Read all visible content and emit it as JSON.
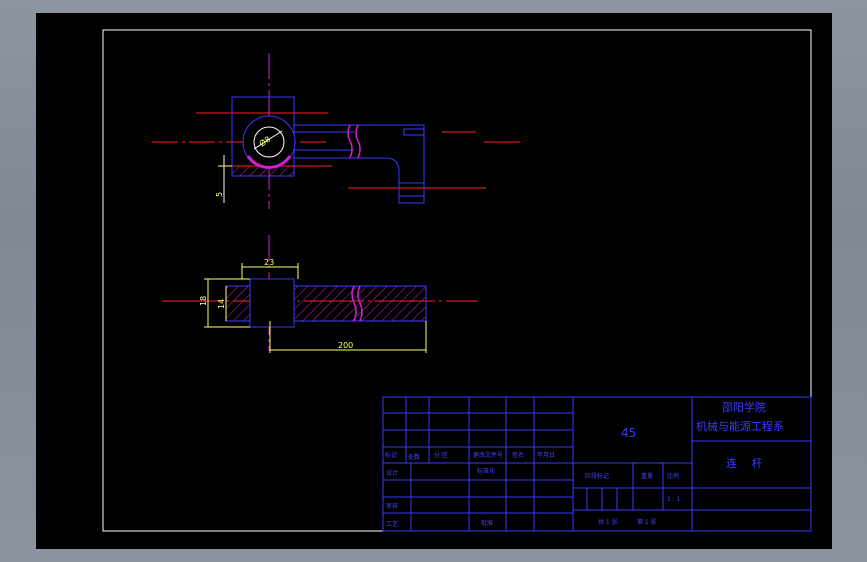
{
  "drawing": {
    "dimensions": {
      "d_hole": "Ø8",
      "d_offset": "5",
      "d_width": "23",
      "d_height_outer": "18",
      "d_height_inner": "14",
      "d_length": "200"
    }
  },
  "title_block": {
    "material": "45",
    "school": "邵阳学院",
    "department": "机械与能源工程系",
    "part_name": "连　 杆",
    "labels": {
      "mark": "标记",
      "count": "处数",
      "zone": "分 区",
      "change_doc": "更改文件号",
      "sign": "签名",
      "date": "年月日",
      "design": "设计",
      "standardize": "标准化",
      "stage_mark": "阶段标记",
      "weight": "重量",
      "scale": "比例",
      "scale_value": "1 : 1",
      "review": "审核",
      "process": "工艺",
      "approve": "批准",
      "sheets_total": "共 1 张",
      "sheet_no": "第 1 张"
    }
  }
}
